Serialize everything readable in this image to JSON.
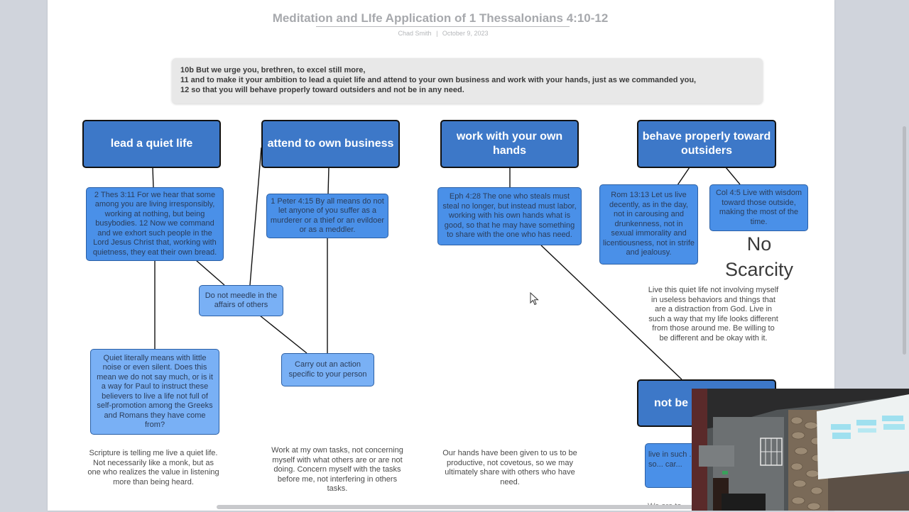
{
  "document": {
    "title": "Meditation and LIfe Application of 1 Thessalonians 4:10-12",
    "author": "Chad Smith",
    "separator": "|",
    "date": "October 9, 2023",
    "verses": [
      "10b But we urge you, brethren, to excel still more,",
      "11 and to make it your ambition to lead a quiet life and attend to your own business and work with your hands, just as we commanded you,",
      "12 so that you will behave properly toward outsiders and not be in any need."
    ]
  },
  "headings": {
    "quiet": "lead a quiet life",
    "business": "attend to own business",
    "hands": "work with your own hands",
    "outsiders": "behave properly toward outsiders",
    "need": "not be in any need"
  },
  "nodes": {
    "thes": "2 Thes 3:11 For we hear that some among you are living irresponsibly, working at nothing, but being busybodies. 12 Now we command and we exhort such people in the Lord Jesus Christ that, working with quietness, they eat their own bread.",
    "peter": "1 Peter 4:15 By all means do not let anyone of you suffer as a murderer or a thief or an evildoer or as a meddler.",
    "eph": "Eph 4:28 The one who steals must steal no longer, but instead must labor, working with his own hands what is good, so that he may have something to share with the one who has need.",
    "rom": "Rom 13:13 Let us live decently, as in the day, not in carousing and drunkenness, not in sexual immorality and licentiousness, not in strife and jealousy.",
    "col": "Col 4:5 Live with wisdom toward those outside, making the most of the time.",
    "meddle": "Do not meedle in the affairs of others",
    "action": "Carry out an action specific to your person",
    "quiet_meaning": "Quiet literally means with little noise or even silent.  Does this mean we do not say much, or is it a way for Paul to instruct these believers to live a life not full of self-promotion among the Greeks and Romans they have come from?",
    "need_partial": "live in such ... or need so... car..."
  },
  "notes": {
    "no_scarcity": "No Scarcity",
    "outsiders_note": "Live this quiet life not involving myself in useless behaviors and things that are a distraction from God. Live in such a way that my life looks different from those around me.  Be willing to be different and be okay with it.",
    "quiet_note": "Scripture is telling me live a quiet life.  Not necessarily like a monk, but as one who realizes the value in listening more than being heard.",
    "business_note": "Work at my own tasks, not concerning myself with what others are or are not doing.  Concern myself with the tasks before me, not interfering in others tasks.",
    "hands_note": "Our hands have been given to us to be productive, not covetous, so we may ultimately share with others who have need.",
    "need_note_partial": "We are to"
  },
  "colors": {
    "heading_fill": "#3d78c8",
    "node_fill": "#4a90e8",
    "node_light_fill": "#79b0f5",
    "background": "#d0d4dc"
  }
}
